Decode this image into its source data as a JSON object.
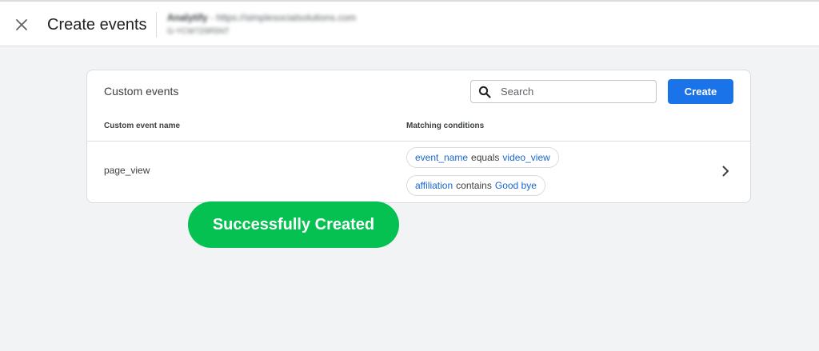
{
  "header": {
    "title": "Create events",
    "close_icon": "close-icon",
    "property_name": "Analytify",
    "property_url": "https://simplesocialsolutions.com",
    "property_id": "G-YCW7Z6R5NT"
  },
  "card": {
    "title": "Custom events",
    "search": {
      "placeholder": "Search",
      "value": "",
      "icon": "search-icon"
    },
    "create_label": "Create",
    "columns": [
      "Custom event name",
      "Matching conditions"
    ],
    "rows": [
      {
        "name": "page_view",
        "conditions": [
          {
            "field": "event_name",
            "operator": "equals",
            "value": "video_view"
          },
          {
            "field": "affiliation",
            "operator": "contains",
            "value": "Good bye"
          }
        ]
      }
    ]
  },
  "toast": {
    "text": "Successfully Created"
  },
  "colors": {
    "accent": "#1a73e8",
    "chip_text": "#1967d2",
    "toast_bg": "#05c151",
    "page_bg": "#f1f3f4"
  }
}
